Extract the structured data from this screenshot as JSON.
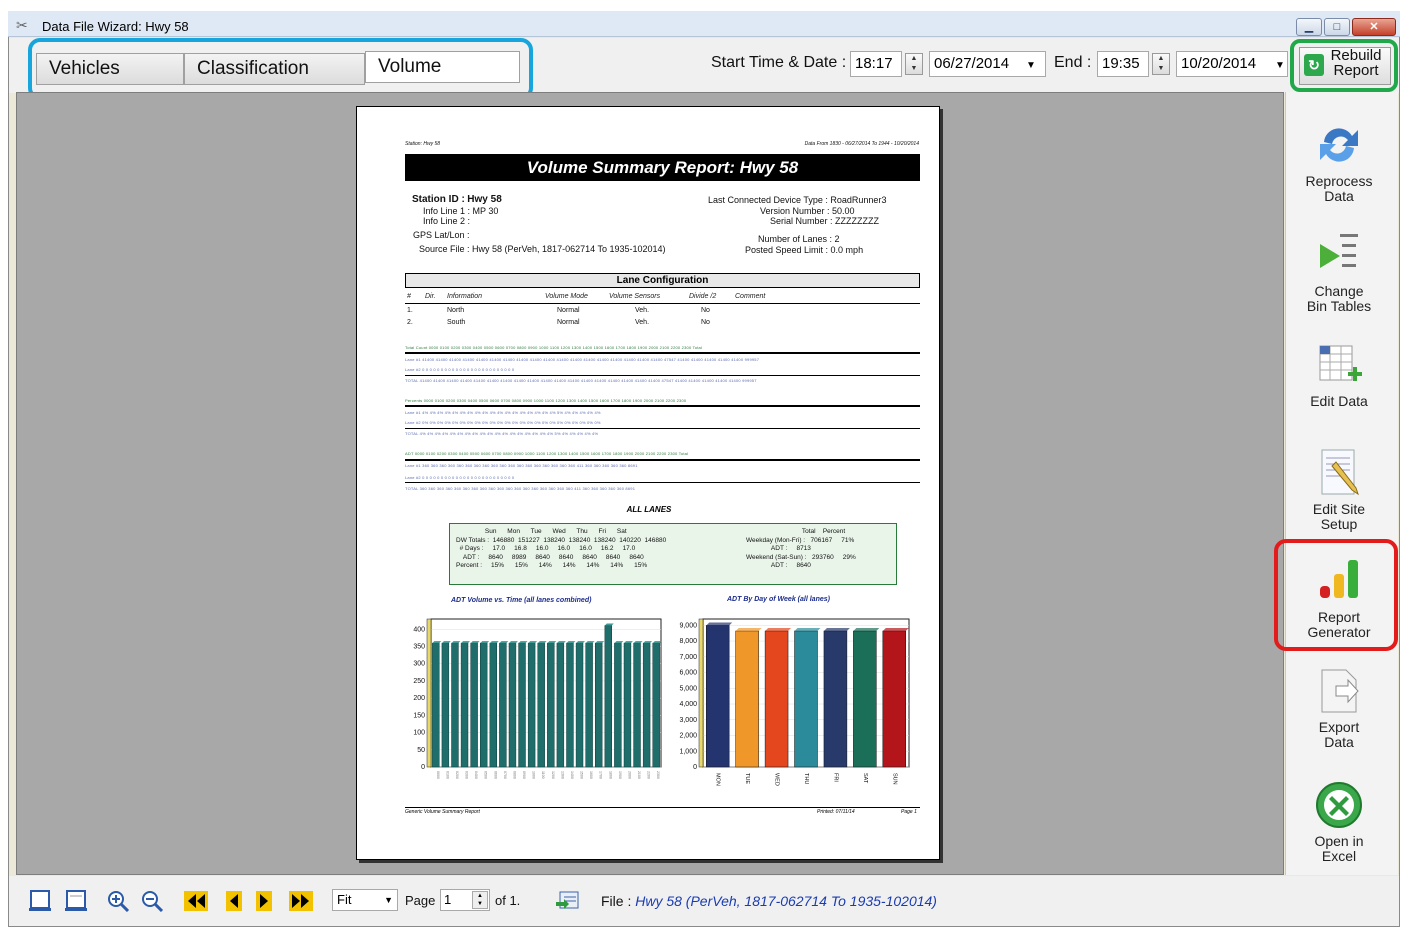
{
  "window": {
    "title": "Data File Wizard: Hwy 58"
  },
  "tabs": [
    {
      "label": "Vehicles"
    },
    {
      "label": "Classification"
    },
    {
      "label": "Volume"
    }
  ],
  "toolbar": {
    "start_label": "Start Time & Date :",
    "start_time": "18:17",
    "start_date": "06/27/2014",
    "end_label": "End :",
    "end_time": "19:35",
    "end_date": "10/20/2014",
    "rebuild_label_1": "Rebuild",
    "rebuild_label_2": "Report"
  },
  "sidebar": [
    {
      "line1": "Reprocess",
      "line2": "Data",
      "icon": "reprocess-icon"
    },
    {
      "line1": "Change",
      "line2": "Bin Tables",
      "icon": "bin-tables-icon"
    },
    {
      "line1": "Edit Data",
      "line2": "",
      "icon": "edit-data-icon"
    },
    {
      "line1": "Edit Site",
      "line2": "Setup",
      "icon": "edit-site-icon"
    },
    {
      "line1": "Report",
      "line2": "Generator",
      "icon": "report-generator-icon"
    },
    {
      "line1": "Export",
      "line2": "Data",
      "icon": "export-icon"
    },
    {
      "line1": "Open in",
      "line2": "Excel",
      "icon": "excel-icon"
    }
  ],
  "report": {
    "station_top": "Station: Hwy 58",
    "data_range_top": "Data From 1830 - 06/27/2014  To 1944 - 10/20/2014",
    "title": "Volume Summary Report: Hwy 58",
    "station_id_label": "Station ID :",
    "station_id": "Hwy 58",
    "info_line1": "Info Line 1 :  MP 30",
    "info_line2": "Info Line 2 :",
    "gps": "GPS Lat/Lon :",
    "source_file": "Source File :  Hwy 58 (PerVeh, 1817-062714 To 1935-102014)",
    "device_type": "Last Connected Device Type :  RoadRunner3",
    "version": "Version Number :  50.00",
    "serial": "Serial Number :  ZZZZZZZZ",
    "lanes": "Number of Lanes :  2",
    "speed": "Posted Speed Limit :  0.0 mph",
    "lane_config_title": "Lane Configuration",
    "lane_cols": [
      "#",
      "Dir.",
      "Information",
      "Volume Mode",
      "Volume Sensors",
      "Divide /2",
      "Comment"
    ],
    "lane_rows": [
      [
        "1.",
        "North",
        "Normal",
        "Veh.",
        "No"
      ],
      [
        "2.",
        "South",
        "Normal",
        "Veh.",
        "No"
      ]
    ],
    "count_header": "Total Count     0000  0100  0200  0300  0400  0500  0600  0700  0800  0900  1000  1100  1200  1300  1400  1500  1600  1700  1800  1900  2000  2100  2200  2300   Total",
    "count_rows": [
      "Lane #1   41400 41400 41400 41400 41400 41400 41400 41400 41400 41400 41400 41400 41400 41400 41400 41400 41400 41400 47547 41400 41400 41400 41400 41400  999957",
      "Lane #2       0     0     0     0     0     0     0     0     0     0     0     0     0     0     0     0     0     0     0     0     0     0     0     0       0",
      "TOTAL     41400 41400 41400 41400 41400 41400 41400 41400 41400 41400 41400 41400 41400 41400 41400 41400 41400 41400 47547 41400 41400 41400 41400 41400  999957"
    ],
    "pct_header": "Percents        0000  0100  0200  0300  0400  0500  0600  0700  0800  0900  1000  1100  1200  1300  1400  1500  1600  1700  1800  1900  2000  2100  2200  2300",
    "pct_rows": [
      "Lane #1     4%   4%   4%   4%   4%   4%   4%   4%   4%   4%   4%   4%   4%   4%   4%   4%   4%   4%   5%   4%   4%   4%   4%   4%",
      "Lane #2     0%   0%   0%   0%   0%   0%   0%   0%   0%   0%   0%   0%   0%   0%   0%   0%   0%   0%   0%   0%   0%   0%   0%   0%",
      "TOTAL       4%   4%   4%   4%   4%   4%   4%   4%   4%   4%   4%   4%   4%   4%   4%   4%   4%   4%   5%   4%   4%   4%   4%   4%"
    ],
    "adt_header": "ADT             0000  0100  0200  0300  0400  0500  0600  0700  0800  0900  1000  1100  1200  1300  1400  1500  1600  1700  1800  1900  2000  2100  2200  2300   Total",
    "adt_rows": [
      "Lane #1    360  360  360  360  360  360  360  360  360  360  360  360  360  360  360  360  360  360  411  360  360  360  360  360   8691",
      "Lane #2      0    0    0    0    0    0    0    0    0    0    0    0    0    0    0    0    0    0    0    0    0    0    0    0      0",
      "TOTAL      360  360  360  360  360  360  360  360  360  360  360  360  360  360  360  360  360  360  411  360  360  360  360  360   8691"
    ],
    "all_lanes": "ALL LANES",
    "summary_left": "                Sun      Mon      Tue      Wed      Thu      Fri      Sat\nDW Totals :  146880  151227  138240  138240  138240  140220  146880\n  # Days :     17.0     16.8     16.0     16.0     16.0     16.2     17.0\n    ADT :     8640     8989     8640     8640     8640     8640     8640\nPercent :     15%      15%      14%      14%      14%      14%      15%",
    "summary_right": "                               Total    Percent\nWeekday (Mon-Fri) :   706167     71%\n              ADT :     8713\nWeekend (Sat-Sun) :   293760     29%\n              ADT :     8640",
    "footer_left": "Generic Volume Summary Report",
    "footer_mid": "Printed: 07/11/14",
    "footer_right": "Page 1"
  },
  "chart_data": [
    {
      "type": "bar",
      "title": "ADT Volume vs. Time (all lanes combined)",
      "categories": [
        "0000",
        "0100",
        "0200",
        "0300",
        "0400",
        "0500",
        "0600",
        "0700",
        "0800",
        "0900",
        "1000",
        "1100",
        "1200",
        "1300",
        "1400",
        "1500",
        "1600",
        "1700",
        "1800",
        "1900",
        "2000",
        "2100",
        "2200",
        "2300"
      ],
      "values": [
        360,
        360,
        360,
        360,
        360,
        360,
        360,
        360,
        360,
        360,
        360,
        360,
        360,
        360,
        360,
        360,
        360,
        360,
        411,
        360,
        360,
        360,
        360,
        360
      ],
      "yticks": [
        0,
        50,
        100,
        150,
        200,
        250,
        300,
        350,
        400
      ],
      "ylim": [
        0,
        430
      ],
      "color": "#1f6e6b"
    },
    {
      "type": "bar",
      "title": "ADT By Day of Week (all lanes)",
      "categories": [
        "MON",
        "TUE",
        "WED",
        "THU",
        "FRI",
        "SAT",
        "SUN"
      ],
      "values": [
        8989,
        8640,
        8640,
        8640,
        8640,
        8640,
        8640
      ],
      "colors": [
        "#24346e",
        "#f0972a",
        "#e4461d",
        "#2b8b9a",
        "#283a6a",
        "#1b6f58",
        "#b3151b"
      ],
      "yticks": [
        0,
        1000,
        2000,
        3000,
        4000,
        5000,
        6000,
        7000,
        8000,
        9000
      ],
      "ytick_labels": [
        "0",
        "1,000",
        "2,000",
        "3,000",
        "4,000",
        "5,000",
        "6,000",
        "7,000",
        "8,000",
        "9,000"
      ],
      "ylim": [
        0,
        9400
      ]
    }
  ],
  "bottombar": {
    "zoom": "Fit",
    "page_label": "Page",
    "page_value": "1",
    "of_label": "of 1.",
    "file_label": "File :",
    "file_value": "Hwy 58 (PerVeh, 1817-062714 To 1935-102014)"
  }
}
